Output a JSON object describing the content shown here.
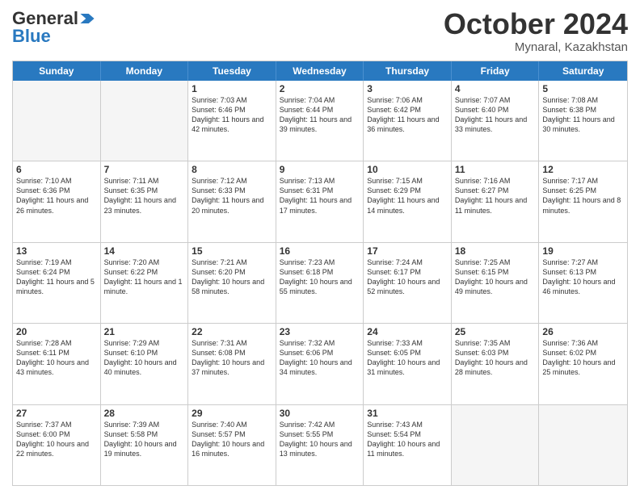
{
  "logo": {
    "line1": "General",
    "line2": "Blue",
    "arrow_color": "#2979c0"
  },
  "title": "October 2024",
  "location": "Mynaral, Kazakhstan",
  "header": {
    "days": [
      "Sunday",
      "Monday",
      "Tuesday",
      "Wednesday",
      "Thursday",
      "Friday",
      "Saturday"
    ]
  },
  "weeks": [
    [
      {
        "day": "",
        "sunrise": "",
        "sunset": "",
        "daylight": ""
      },
      {
        "day": "",
        "sunrise": "",
        "sunset": "",
        "daylight": ""
      },
      {
        "day": "1",
        "sunrise": "Sunrise: 7:03 AM",
        "sunset": "Sunset: 6:46 PM",
        "daylight": "Daylight: 11 hours and 42 minutes."
      },
      {
        "day": "2",
        "sunrise": "Sunrise: 7:04 AM",
        "sunset": "Sunset: 6:44 PM",
        "daylight": "Daylight: 11 hours and 39 minutes."
      },
      {
        "day": "3",
        "sunrise": "Sunrise: 7:06 AM",
        "sunset": "Sunset: 6:42 PM",
        "daylight": "Daylight: 11 hours and 36 minutes."
      },
      {
        "day": "4",
        "sunrise": "Sunrise: 7:07 AM",
        "sunset": "Sunset: 6:40 PM",
        "daylight": "Daylight: 11 hours and 33 minutes."
      },
      {
        "day": "5",
        "sunrise": "Sunrise: 7:08 AM",
        "sunset": "Sunset: 6:38 PM",
        "daylight": "Daylight: 11 hours and 30 minutes."
      }
    ],
    [
      {
        "day": "6",
        "sunrise": "Sunrise: 7:10 AM",
        "sunset": "Sunset: 6:36 PM",
        "daylight": "Daylight: 11 hours and 26 minutes."
      },
      {
        "day": "7",
        "sunrise": "Sunrise: 7:11 AM",
        "sunset": "Sunset: 6:35 PM",
        "daylight": "Daylight: 11 hours and 23 minutes."
      },
      {
        "day": "8",
        "sunrise": "Sunrise: 7:12 AM",
        "sunset": "Sunset: 6:33 PM",
        "daylight": "Daylight: 11 hours and 20 minutes."
      },
      {
        "day": "9",
        "sunrise": "Sunrise: 7:13 AM",
        "sunset": "Sunset: 6:31 PM",
        "daylight": "Daylight: 11 hours and 17 minutes."
      },
      {
        "day": "10",
        "sunrise": "Sunrise: 7:15 AM",
        "sunset": "Sunset: 6:29 PM",
        "daylight": "Daylight: 11 hours and 14 minutes."
      },
      {
        "day": "11",
        "sunrise": "Sunrise: 7:16 AM",
        "sunset": "Sunset: 6:27 PM",
        "daylight": "Daylight: 11 hours and 11 minutes."
      },
      {
        "day": "12",
        "sunrise": "Sunrise: 7:17 AM",
        "sunset": "Sunset: 6:25 PM",
        "daylight": "Daylight: 11 hours and 8 minutes."
      }
    ],
    [
      {
        "day": "13",
        "sunrise": "Sunrise: 7:19 AM",
        "sunset": "Sunset: 6:24 PM",
        "daylight": "Daylight: 11 hours and 5 minutes."
      },
      {
        "day": "14",
        "sunrise": "Sunrise: 7:20 AM",
        "sunset": "Sunset: 6:22 PM",
        "daylight": "Daylight: 11 hours and 1 minute."
      },
      {
        "day": "15",
        "sunrise": "Sunrise: 7:21 AM",
        "sunset": "Sunset: 6:20 PM",
        "daylight": "Daylight: 10 hours and 58 minutes."
      },
      {
        "day": "16",
        "sunrise": "Sunrise: 7:23 AM",
        "sunset": "Sunset: 6:18 PM",
        "daylight": "Daylight: 10 hours and 55 minutes."
      },
      {
        "day": "17",
        "sunrise": "Sunrise: 7:24 AM",
        "sunset": "Sunset: 6:17 PM",
        "daylight": "Daylight: 10 hours and 52 minutes."
      },
      {
        "day": "18",
        "sunrise": "Sunrise: 7:25 AM",
        "sunset": "Sunset: 6:15 PM",
        "daylight": "Daylight: 10 hours and 49 minutes."
      },
      {
        "day": "19",
        "sunrise": "Sunrise: 7:27 AM",
        "sunset": "Sunset: 6:13 PM",
        "daylight": "Daylight: 10 hours and 46 minutes."
      }
    ],
    [
      {
        "day": "20",
        "sunrise": "Sunrise: 7:28 AM",
        "sunset": "Sunset: 6:11 PM",
        "daylight": "Daylight: 10 hours and 43 minutes."
      },
      {
        "day": "21",
        "sunrise": "Sunrise: 7:29 AM",
        "sunset": "Sunset: 6:10 PM",
        "daylight": "Daylight: 10 hours and 40 minutes."
      },
      {
        "day": "22",
        "sunrise": "Sunrise: 7:31 AM",
        "sunset": "Sunset: 6:08 PM",
        "daylight": "Daylight: 10 hours and 37 minutes."
      },
      {
        "day": "23",
        "sunrise": "Sunrise: 7:32 AM",
        "sunset": "Sunset: 6:06 PM",
        "daylight": "Daylight: 10 hours and 34 minutes."
      },
      {
        "day": "24",
        "sunrise": "Sunrise: 7:33 AM",
        "sunset": "Sunset: 6:05 PM",
        "daylight": "Daylight: 10 hours and 31 minutes."
      },
      {
        "day": "25",
        "sunrise": "Sunrise: 7:35 AM",
        "sunset": "Sunset: 6:03 PM",
        "daylight": "Daylight: 10 hours and 28 minutes."
      },
      {
        "day": "26",
        "sunrise": "Sunrise: 7:36 AM",
        "sunset": "Sunset: 6:02 PM",
        "daylight": "Daylight: 10 hours and 25 minutes."
      }
    ],
    [
      {
        "day": "27",
        "sunrise": "Sunrise: 7:37 AM",
        "sunset": "Sunset: 6:00 PM",
        "daylight": "Daylight: 10 hours and 22 minutes."
      },
      {
        "day": "28",
        "sunrise": "Sunrise: 7:39 AM",
        "sunset": "Sunset: 5:58 PM",
        "daylight": "Daylight: 10 hours and 19 minutes."
      },
      {
        "day": "29",
        "sunrise": "Sunrise: 7:40 AM",
        "sunset": "Sunset: 5:57 PM",
        "daylight": "Daylight: 10 hours and 16 minutes."
      },
      {
        "day": "30",
        "sunrise": "Sunrise: 7:42 AM",
        "sunset": "Sunset: 5:55 PM",
        "daylight": "Daylight: 10 hours and 13 minutes."
      },
      {
        "day": "31",
        "sunrise": "Sunrise: 7:43 AM",
        "sunset": "Sunset: 5:54 PM",
        "daylight": "Daylight: 10 hours and 11 minutes."
      },
      {
        "day": "",
        "sunrise": "",
        "sunset": "",
        "daylight": ""
      },
      {
        "day": "",
        "sunrise": "",
        "sunset": "",
        "daylight": ""
      }
    ]
  ]
}
